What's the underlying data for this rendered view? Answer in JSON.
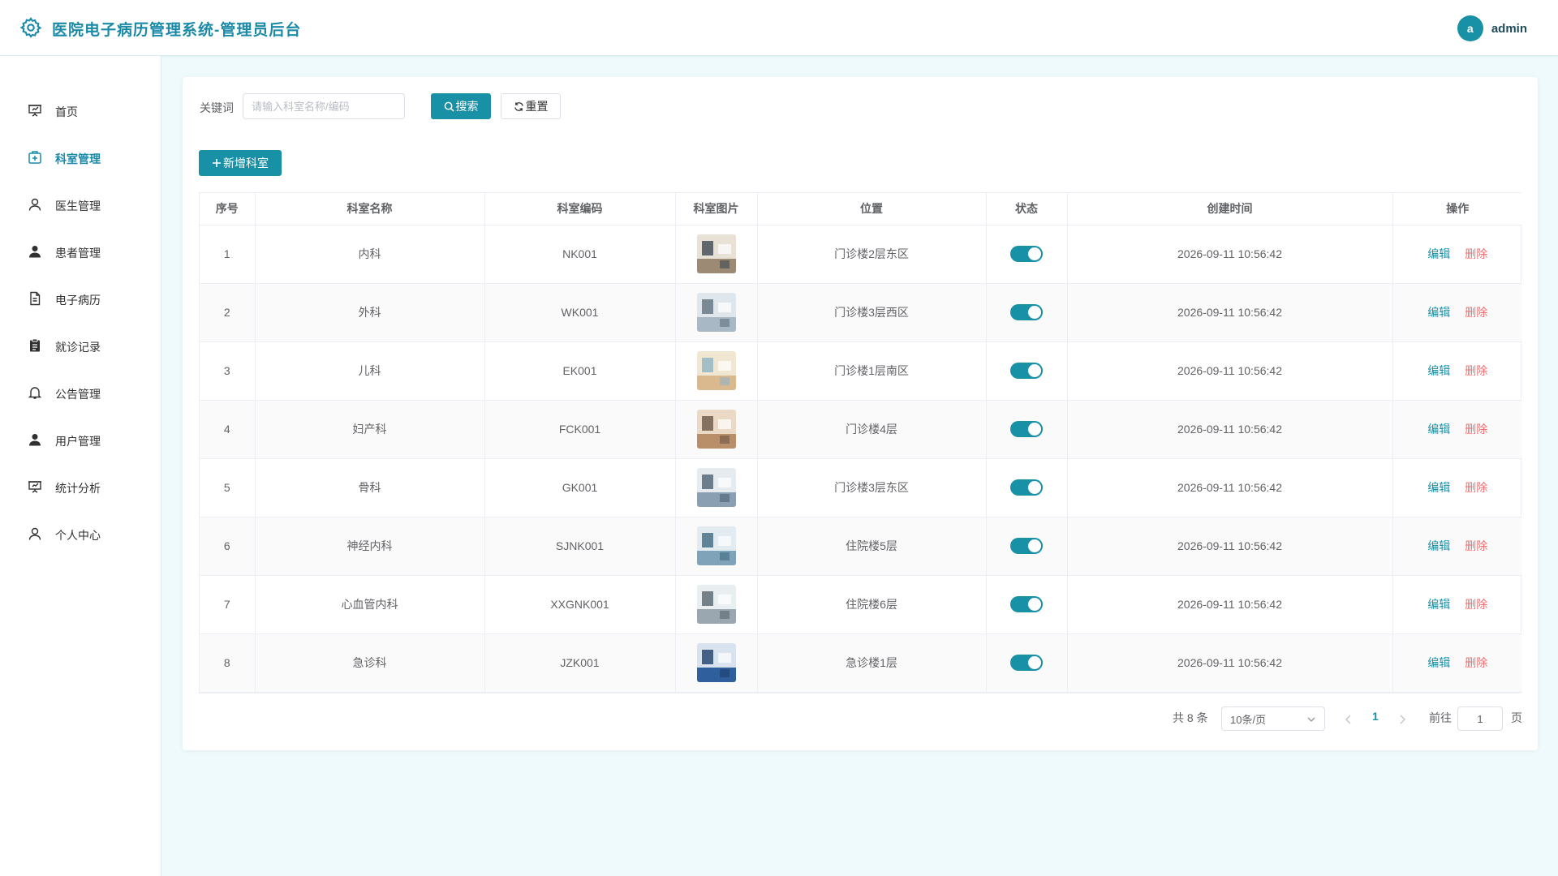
{
  "header": {
    "title": "医院电子病历管理系统-管理员后台",
    "avatar_letter": "a",
    "username": "admin",
    "accent": "#1890a6"
  },
  "sidebar": {
    "items": [
      {
        "label": "首页",
        "icon": "presentation-icon"
      },
      {
        "label": "科室管理",
        "icon": "medical-kit-icon",
        "active": true
      },
      {
        "label": "医生管理",
        "icon": "user-outline-icon"
      },
      {
        "label": "患者管理",
        "icon": "user-filled-icon"
      },
      {
        "label": "电子病历",
        "icon": "document-icon"
      },
      {
        "label": "就诊记录",
        "icon": "clipboard-icon"
      },
      {
        "label": "公告管理",
        "icon": "bell-icon"
      },
      {
        "label": "用户管理",
        "icon": "user-filled-icon"
      },
      {
        "label": "统计分析",
        "icon": "chart-board-icon"
      },
      {
        "label": "个人中心",
        "icon": "user-outline-icon"
      }
    ]
  },
  "search": {
    "label": "关键词",
    "placeholder": "请输入科室名称/编码",
    "search_button": "搜索",
    "reset_button": "重置"
  },
  "toolbar": {
    "add_button": "新增科室"
  },
  "table": {
    "columns": [
      "序号",
      "科室名称",
      "科室编码",
      "科室图片",
      "位置",
      "状态",
      "创建时间",
      "操作"
    ],
    "action_edit": "编辑",
    "action_delete": "删除",
    "rows": [
      {
        "index": "1",
        "name": "内科",
        "code": "NK001",
        "location": "门诊楼2层东区",
        "enabled": true,
        "created": "2026-09-11 10:56:42"
      },
      {
        "index": "2",
        "name": "外科",
        "code": "WK001",
        "location": "门诊楼3层西区",
        "enabled": true,
        "created": "2026-09-11 10:56:42"
      },
      {
        "index": "3",
        "name": "儿科",
        "code": "EK001",
        "location": "门诊楼1层南区",
        "enabled": true,
        "created": "2026-09-11 10:56:42"
      },
      {
        "index": "4",
        "name": "妇产科",
        "code": "FCK001",
        "location": "门诊楼4层",
        "enabled": true,
        "created": "2026-09-11 10:56:42"
      },
      {
        "index": "5",
        "name": "骨科",
        "code": "GK001",
        "location": "门诊楼3层东区",
        "enabled": true,
        "created": "2026-09-11 10:56:42"
      },
      {
        "index": "6",
        "name": "神经内科",
        "code": "SJNK001",
        "location": "住院楼5层",
        "enabled": true,
        "created": "2026-09-11 10:56:42"
      },
      {
        "index": "7",
        "name": "心血管内科",
        "code": "XXGNK001",
        "location": "住院楼6层",
        "enabled": true,
        "created": "2026-09-11 10:56:42"
      },
      {
        "index": "8",
        "name": "急诊科",
        "code": "JZK001",
        "location": "急诊楼1层",
        "enabled": true,
        "created": "2026-09-11 10:56:42"
      }
    ]
  },
  "pagination": {
    "total_text": "共 8 条",
    "page_size": "10条/页",
    "current_page": "1",
    "goto_label": "前往",
    "goto_value": "1",
    "page_unit": "页"
  }
}
